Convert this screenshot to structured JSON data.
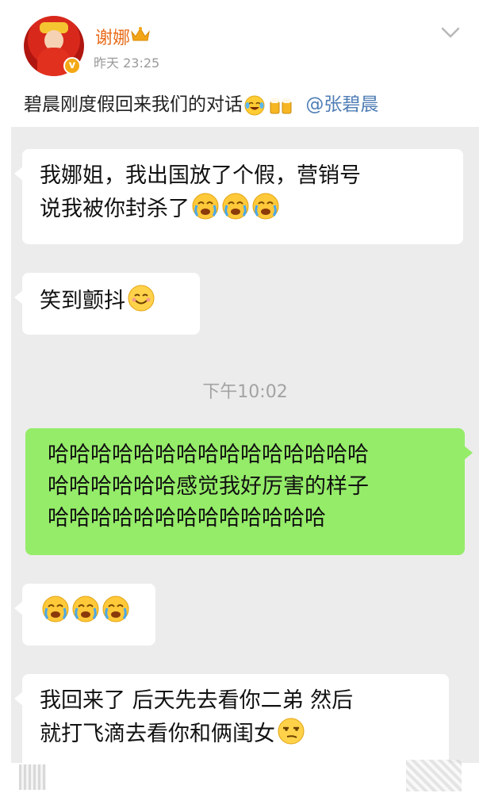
{
  "post": {
    "username": "谢娜",
    "time": "昨天 23:25",
    "text": "碧晨刚度假回来我们的对话",
    "mention": "@张碧晨",
    "verified_badge": "v",
    "icons": [
      "crown-icon",
      "chevron-down-icon",
      "laugh-cry-emoji",
      "beer-cheers-emoji"
    ]
  },
  "chat": {
    "messages": [
      {
        "side": "left",
        "line1": "我娜姐，我出国放了个假，营销号",
        "line2": "说我被你封杀了",
        "emoji": [
          "sob-emoji",
          "sob-emoji",
          "sob-emoji"
        ]
      },
      {
        "side": "left",
        "text": "笑到颤抖",
        "emoji": [
          "smile-emoji"
        ]
      },
      {
        "side": "right",
        "line1": "哈哈哈哈哈哈哈哈哈哈哈哈哈哈哈",
        "line2": "哈哈哈哈哈哈感觉我好厉害的样子",
        "line3": "哈哈哈哈哈哈哈哈哈哈哈哈哈"
      },
      {
        "side": "left",
        "text": "",
        "emoji": [
          "sob-emoji",
          "sob-emoji",
          "sob-emoji"
        ]
      },
      {
        "side": "left",
        "line1": "我回来了 后天先去看你二弟 然后",
        "line2": "就打飞滴去看你和俩闺女",
        "emoji": [
          "smirk-emoji"
        ]
      }
    ],
    "timestamp": "下午10:02",
    "colors": {
      "background": "#ececec",
      "incoming": "#ffffff",
      "outgoing": "#95ec69"
    }
  }
}
